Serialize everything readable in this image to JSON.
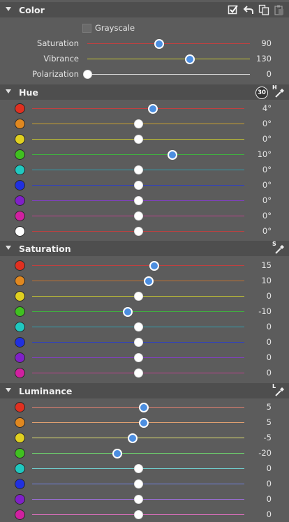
{
  "color": {
    "title": "Color",
    "grayscale_label": "Grayscale",
    "sliders": [
      {
        "label": "Saturation",
        "value": "90",
        "pos": 0.44,
        "thumb": "blue",
        "track": "#c04040"
      },
      {
        "label": "Vibrance",
        "value": "130",
        "pos": 0.63,
        "thumb": "blue",
        "track": "#c8c830"
      },
      {
        "label": "Polarization",
        "value": "0",
        "pos": 0.0,
        "thumb": "white",
        "track": "#e0e0e0"
      }
    ]
  },
  "hue": {
    "title": "Hue",
    "badge": "30",
    "picker_letter": "H",
    "rows": [
      {
        "swatch": "#e03020",
        "value": "4°",
        "pos": 0.57,
        "thumb": "blue",
        "track": "#c04040"
      },
      {
        "swatch": "#e08820",
        "value": "0°",
        "pos": 0.5,
        "thumb": "white",
        "track": "#c8a030"
      },
      {
        "swatch": "#e0d020",
        "value": "0°",
        "pos": 0.5,
        "thumb": "white",
        "track": "#c8c830"
      },
      {
        "swatch": "#40c020",
        "value": "10°",
        "pos": 0.66,
        "thumb": "blue",
        "track": "#40b040"
      },
      {
        "swatch": "#20c8c0",
        "value": "0°",
        "pos": 0.5,
        "thumb": "white",
        "track": "#30a0b0"
      },
      {
        "swatch": "#2030e0",
        "value": "0°",
        "pos": 0.5,
        "thumb": "white",
        "track": "#3040c0"
      },
      {
        "swatch": "#8020c8",
        "value": "0°",
        "pos": 0.5,
        "thumb": "white",
        "track": "#8040c0"
      },
      {
        "swatch": "#d020a0",
        "value": "0°",
        "pos": 0.5,
        "thumb": "white",
        "track": "#c04090"
      },
      {
        "swatch": "#ffffff",
        "value": "0°",
        "pos": 0.5,
        "thumb": "white",
        "track": "#c04040"
      }
    ]
  },
  "saturation": {
    "title": "Saturation",
    "picker_letter": "S",
    "rows": [
      {
        "swatch": "#e03020",
        "value": "15",
        "pos": 0.575,
        "thumb": "blue",
        "track": "#c04040"
      },
      {
        "swatch": "#e08820",
        "value": "10",
        "pos": 0.55,
        "thumb": "blue",
        "track": "#c07030"
      },
      {
        "swatch": "#e0d020",
        "value": "0",
        "pos": 0.5,
        "thumb": "white",
        "track": "#c8c830"
      },
      {
        "swatch": "#40c020",
        "value": "-10",
        "pos": 0.45,
        "thumb": "blue",
        "track": "#40b040"
      },
      {
        "swatch": "#20c8c0",
        "value": "0",
        "pos": 0.5,
        "thumb": "white",
        "track": "#30a0b0"
      },
      {
        "swatch": "#2030e0",
        "value": "0",
        "pos": 0.5,
        "thumb": "white",
        "track": "#3040c0"
      },
      {
        "swatch": "#8020c8",
        "value": "0",
        "pos": 0.5,
        "thumb": "white",
        "track": "#8040c0"
      },
      {
        "swatch": "#d020a0",
        "value": "0",
        "pos": 0.5,
        "thumb": "white",
        "track": "#c04090"
      }
    ]
  },
  "luminance": {
    "title": "Luminance",
    "picker_letter": "L",
    "rows": [
      {
        "swatch": "#e03020",
        "value": "5",
        "pos": 0.525,
        "thumb": "blue",
        "track": "#e08070"
      },
      {
        "swatch": "#e08820",
        "value": "5",
        "pos": 0.525,
        "thumb": "blue",
        "track": "#e0a070"
      },
      {
        "swatch": "#e0d020",
        "value": "-5",
        "pos": 0.475,
        "thumb": "blue",
        "track": "#e0e070"
      },
      {
        "swatch": "#40c020",
        "value": "-20",
        "pos": 0.4,
        "thumb": "blue",
        "track": "#70e070"
      },
      {
        "swatch": "#20c8c0",
        "value": "0",
        "pos": 0.5,
        "thumb": "white",
        "track": "#70d0d0"
      },
      {
        "swatch": "#2030e0",
        "value": "0",
        "pos": 0.5,
        "thumb": "white",
        "track": "#7080e0"
      },
      {
        "swatch": "#8020c8",
        "value": "0",
        "pos": 0.5,
        "thumb": "white",
        "track": "#a070e0"
      },
      {
        "swatch": "#d020a0",
        "value": "0",
        "pos": 0.5,
        "thumb": "white",
        "track": "#e070c0"
      }
    ]
  },
  "icons": {
    "color_header": [
      "checkbox-icon",
      "undo-icon",
      "copy-icon",
      "paste-icon"
    ],
    "picker": "eyedropper-icon"
  }
}
